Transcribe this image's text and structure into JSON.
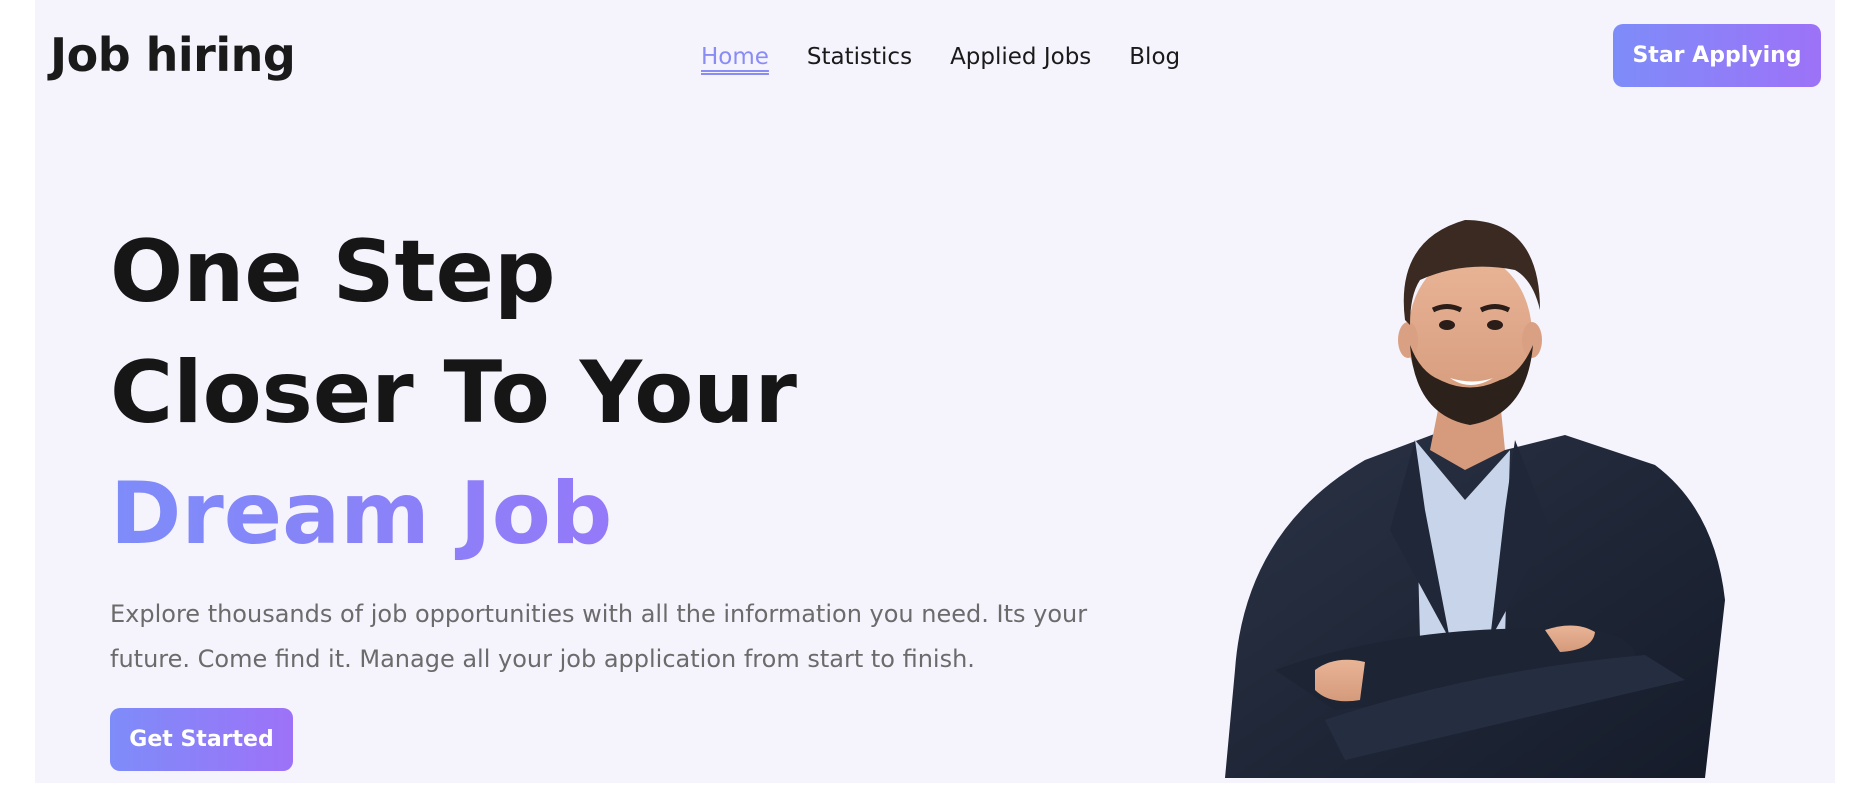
{
  "header": {
    "logo": "Job hiring",
    "nav": [
      {
        "label": "Home",
        "active": true
      },
      {
        "label": "Statistics",
        "active": false
      },
      {
        "label": "Applied Jobs",
        "active": false
      },
      {
        "label": "Blog",
        "active": false
      }
    ],
    "cta_label": "Star Applying"
  },
  "hero": {
    "title_line1": "One Step",
    "title_line2": "Closer To Your",
    "title_accent": "Dream Job",
    "description": "Explore thousands of job opportunities with all the information you need. Its your future. Come find it. Manage all your job application from start to finish.",
    "cta_label": "Get Started"
  },
  "colors": {
    "accent_start": "#7e8cf9",
    "accent_end": "#9d72f7",
    "background": "#f5f4fd",
    "text": "#1a1a1a",
    "muted_text": "#6b6b6b"
  }
}
